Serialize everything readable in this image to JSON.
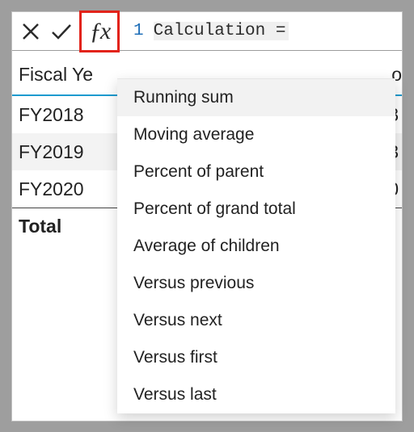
{
  "formulaBar": {
    "lineNumber": "1",
    "expression": "Calculation ="
  },
  "table": {
    "headerLeft": "Fiscal Ye",
    "headerRightFragment": "o",
    "rows": [
      {
        "label": "FY2018",
        "valueFragment": "8"
      },
      {
        "label": "FY2019",
        "valueFragment": "3"
      },
      {
        "label": "FY2020",
        "valueFragment": "0"
      }
    ],
    "totalLabel": "Total",
    "totalValueFragment": ""
  },
  "dropdown": {
    "items": [
      "Running sum",
      "Moving average",
      "Percent of parent",
      "Percent of grand total",
      "Average of children",
      "Versus previous",
      "Versus next",
      "Versus first",
      "Versus last"
    ]
  }
}
